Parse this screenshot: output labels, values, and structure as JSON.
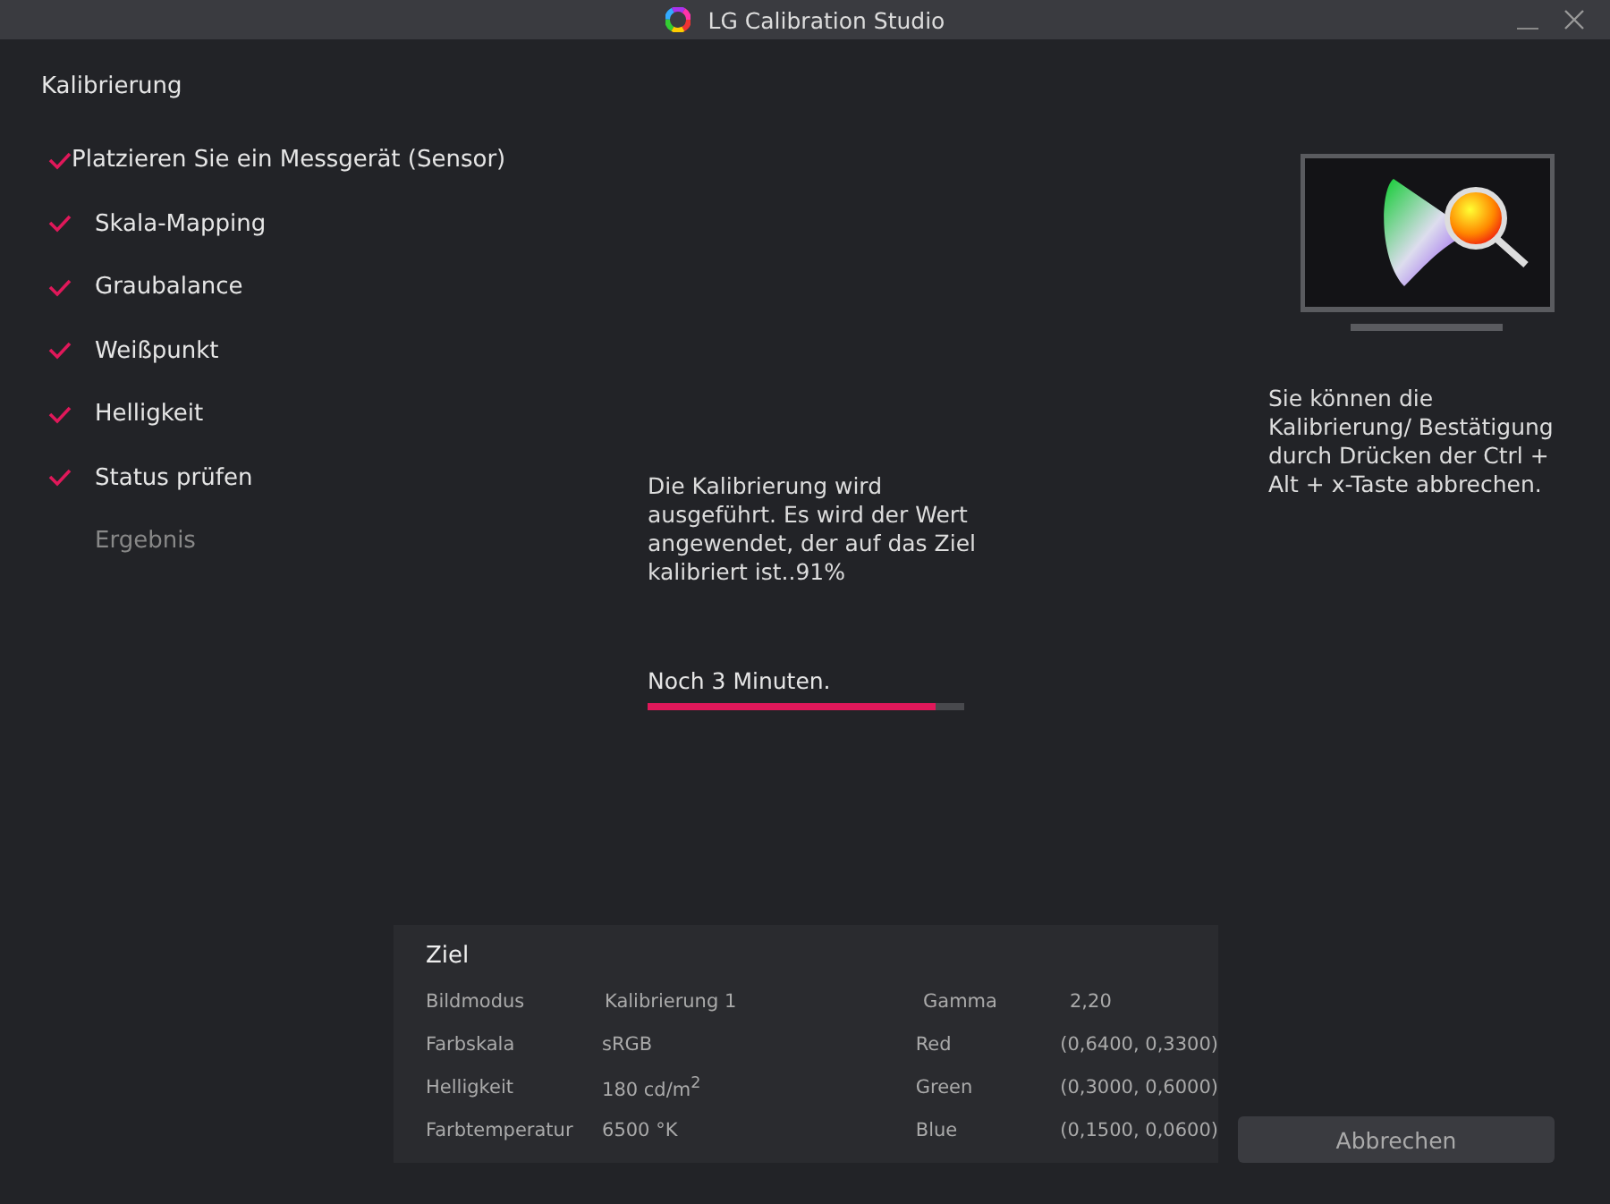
{
  "window": {
    "title": "LG Calibration Studio"
  },
  "sidebar": {
    "title": "Kalibrierung",
    "steps": [
      {
        "label": "Platzieren Sie ein Messgerät (Sensor)",
        "done": true
      },
      {
        "label": "Skala-Mapping",
        "done": true
      },
      {
        "label": "Graubalance",
        "done": true
      },
      {
        "label": "Weißpunkt",
        "done": true
      },
      {
        "label": "Helligkeit",
        "done": true
      },
      {
        "label": "Status prüfen",
        "done": true
      },
      {
        "label": "Ergebnis",
        "done": false
      }
    ]
  },
  "progress": {
    "message": "Die Kalibrierung wird ausgeführt. Es wird der Wert angewendet, der auf das Ziel kalibriert ist..91%",
    "remaining": "Noch 3 Minuten.",
    "level": 0.91
  },
  "hint": "Sie können die Kalibrierung/ Bestätigung durch Drücken der Ctrl + Alt + x-Taste abbrechen.",
  "target": {
    "title": "Ziel",
    "rows": [
      {
        "label": "Bildmodus",
        "value": "Kalibrierung 1",
        "label_2": "Gamma",
        "value_2": "2,20"
      },
      {
        "label": "Farbskala",
        "value": "sRGB",
        "label_2": "Red",
        "value_2": "(0,6400, 0,3300)"
      },
      {
        "label": "Helligkeit",
        "value": "180  cd/m$^{2}$",
        "label_2": "Green",
        "value_2": "(0,3000, 0,6000)"
      },
      {
        "label": "Farbtemperatur",
        "value": "6500 °K",
        "label_2": "Blue",
        "value_2": "(0,1500, 0,0600)"
      }
    ]
  },
  "buttons": [
    "Abbrechen"
  ]
}
